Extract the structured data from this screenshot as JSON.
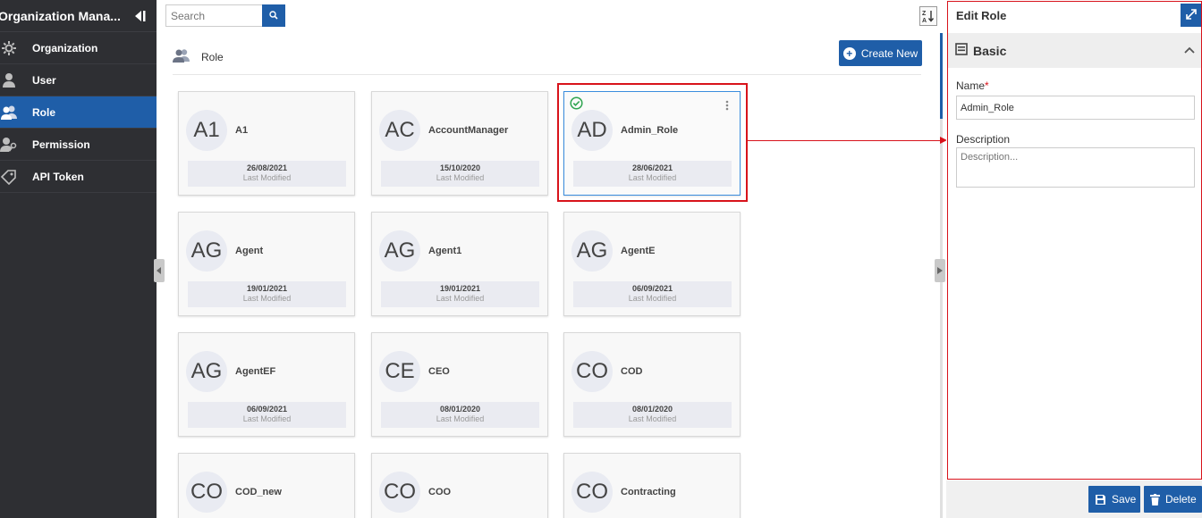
{
  "sidebar": {
    "title": "Organization Mana...",
    "items": [
      {
        "label": "Organization",
        "icon": "gear-icon"
      },
      {
        "label": "User",
        "icon": "user-icon"
      },
      {
        "label": "Role",
        "icon": "users-icon",
        "active": true
      },
      {
        "label": "Permission",
        "icon": "user-key-icon"
      },
      {
        "label": "API Token",
        "icon": "tag-icon"
      }
    ]
  },
  "toolbar": {
    "search_placeholder": "Search",
    "sort_icon": "sort-az-icon"
  },
  "section": {
    "label": "Role",
    "create_label": "Create New"
  },
  "roles": [
    {
      "initials": "A1",
      "name": "A1",
      "date": "26/08/2021",
      "modified_label": "Last Modified"
    },
    {
      "initials": "AC",
      "name": "AccountManager",
      "date": "15/10/2020",
      "modified_label": "Last Modified"
    },
    {
      "initials": "AD",
      "name": "Admin_Role",
      "date": "28/06/2021",
      "modified_label": "Last Modified",
      "selected": true
    },
    {
      "initials": "AG",
      "name": "Agent",
      "date": "19/01/2021",
      "modified_label": "Last Modified"
    },
    {
      "initials": "AG",
      "name": "Agent1",
      "date": "19/01/2021",
      "modified_label": "Last Modified"
    },
    {
      "initials": "AG",
      "name": "AgentE",
      "date": "06/09/2021",
      "modified_label": "Last Modified"
    },
    {
      "initials": "AG",
      "name": "AgentEF",
      "date": "06/09/2021",
      "modified_label": "Last Modified"
    },
    {
      "initials": "CE",
      "name": "CEO",
      "date": "08/01/2020",
      "modified_label": "Last Modified"
    },
    {
      "initials": "CO",
      "name": "COD",
      "date": "08/01/2020",
      "modified_label": "Last Modified"
    },
    {
      "initials": "CO",
      "name": "COD_new",
      "date": "",
      "modified_label": ""
    },
    {
      "initials": "CO",
      "name": "COO",
      "date": "",
      "modified_label": ""
    },
    {
      "initials": "CO",
      "name": "Contracting",
      "date": "",
      "modified_label": ""
    }
  ],
  "edit_panel": {
    "title": "Edit Role",
    "section_title": "Basic",
    "name_label": "Name",
    "required_mark": "*",
    "name_value": "Admin_Role",
    "description_label": "Description",
    "description_placeholder": "Description...",
    "save_label": "Save",
    "delete_label": "Delete"
  },
  "colors": {
    "accent": "#1f5ea8",
    "sidebar_bg": "#2e2f33",
    "highlight": "#d8131b",
    "check": "#2ea44f"
  }
}
